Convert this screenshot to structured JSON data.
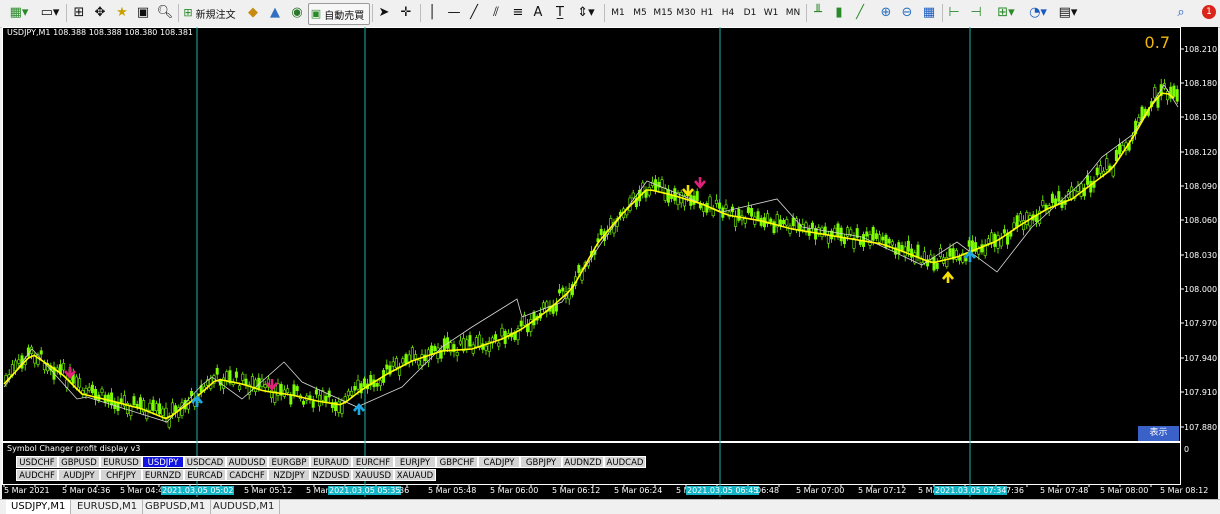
{
  "toolbar": {
    "new_order_label": "新規注文",
    "auto_trading_label": "自動売買",
    "timeframes": [
      "M1",
      "M5",
      "M15",
      "M30",
      "H1",
      "H4",
      "D1",
      "W1",
      "MN"
    ],
    "text_tool_label": "A",
    "notification_count": "1"
  },
  "chart": {
    "title": "USDJPY,M1  108.388 108.388 108.380 108.381",
    "indicator_value": "0.7",
    "price_labels": [
      "108.210",
      "108.180",
      "108.150",
      "108.120",
      "108.090",
      "108.060",
      "108.030",
      "108.000",
      "107.970",
      "107.940",
      "107.910",
      "107.880"
    ],
    "panel_title": "Symbol Changer profit display v3",
    "panel_zero": "0",
    "display_button": "表示",
    "colors": {
      "background": "#000000",
      "candle": "#7cfc00",
      "ma_line": "#ffff00",
      "vertical_line": "#20b2aa",
      "arrow_cyan": "#1ea7e0",
      "arrow_magenta": "#e0207a",
      "arrow_yellow": "#f5e000",
      "zigzag": "#d8d8d8"
    }
  },
  "symbol_buttons_row1": [
    "USDCHF",
    "GBPUSD",
    "EURUSD",
    "USDJPY",
    "USDCAD",
    "AUDUSD",
    "EURGBP",
    "EURAUD",
    "EURCHF",
    "EURJPY",
    "GBPCHF",
    "CADJPY",
    "GBPJPY",
    "AUDNZD",
    "AUDCAD"
  ],
  "symbol_buttons_row2": [
    "AUDCHF",
    "AUDJPY",
    "CHFJPY",
    "EURNZD",
    "EURCAD",
    "CADCHF",
    "NZDJPY",
    "NZDUSD",
    "XAUUSD",
    "XAUAUD"
  ],
  "active_symbol": "USDJPY",
  "time_axis": {
    "labels": [
      "5 Mar 2021",
      "5 Mar 04:36",
      "5 Mar 04:4",
      "5 Mar 05:12",
      "5 Mar",
      "36",
      "5 Mar 05:48",
      "5 Mar 06:00",
      "5 Mar 06:12",
      "5 Mar 06:24",
      "5 Mar",
      "06:48",
      "5 Mar 07:00",
      "5 Mar 07:12",
      "5 Ma",
      "7:36",
      "5 Mar 07:48",
      "5 Mar 08:00",
      "5 Mar 08:12"
    ],
    "highlighted": [
      "2021.03.05 05:02",
      "2021.03.05 05:35",
      "2021.03.05 06:45",
      "2021.03.05 07:34"
    ]
  },
  "tabs": [
    "USDJPY,M1",
    "EURUSD,M1",
    "GBPUSD,M1",
    "AUDUSD,M1"
  ]
}
